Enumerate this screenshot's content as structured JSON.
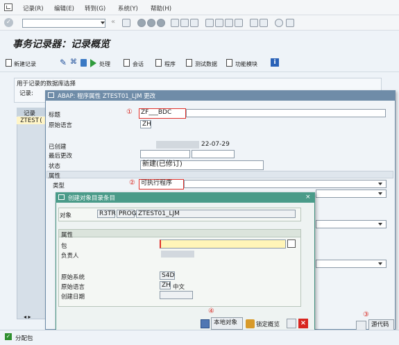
{
  "menu": [
    "记录(R)",
    "编辑(E)",
    "转到(G)",
    "系统(Y)",
    "帮助(H)"
  ],
  "title": "事务记录器：记录概览",
  "app_toolbar": {
    "new_record": "新建记录",
    "process": "处理",
    "session": "会话",
    "program": "程序",
    "test_data": "测试数据",
    "function_module": "功能模块",
    "info": "i"
  },
  "db_group": {
    "title": "用于记录的数据库选择",
    "record_label": "记录:"
  },
  "grid": {
    "header": "记录",
    "first_row": "ZTEST("
  },
  "dialog1": {
    "title": "ABAP: 程序属性 ZTEST01_LJM 更改",
    "label_title": "标题",
    "value_title": "ZF___BDC",
    "label_orig_lang": "原始语言",
    "value_orig_lang": "ZH",
    "label_created": "已创建",
    "value_created_date": "22-07-29",
    "label_last_changed": "最后更改",
    "label_status": "状态",
    "value_status": "新建(已修订)",
    "section_attrs": "属性",
    "label_type": "类型",
    "value_type": "可执行程序",
    "marker1": "①",
    "marker2": "②",
    "marker3": "③",
    "marker4": "④",
    "source_code_button": "源代码"
  },
  "dialog2": {
    "title": "创建对象目录条目",
    "label_object": "对象",
    "val_r3tr": "R3TR",
    "val_prog": "PROG",
    "val_name": "ZTEST01_LJM",
    "section_attrs": "属性",
    "label_package": "包",
    "label_owner": "负责人",
    "label_source_system": "原始系统",
    "value_source_system": "S4D",
    "label_orig_lang": "原始语言",
    "value_orig_lang": "ZH",
    "value_orig_lang_text": "中文",
    "label_created_date": "创建日期",
    "local_object_button": "本地对象",
    "lock_overview_button": "锁定概览"
  },
  "status_bar": {
    "assign_label": "分配包"
  },
  "colors": {
    "dialog1_title": "#6f8ca8",
    "dialog2_title": "#4a9b89",
    "highlight": "#e0302a",
    "package_field": "#fff5b8"
  }
}
